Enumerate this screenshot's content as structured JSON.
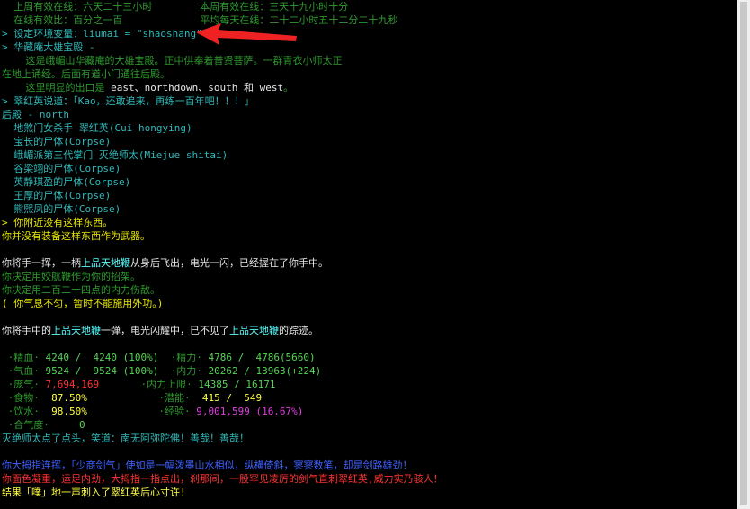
{
  "window": {
    "title": ""
  },
  "lines": {
    "l1a": "  上周有效在线：六天二十三小时",
    "l1b": "本周有效在线：三天十九小时十分",
    "l2a": "  在线有效比：百分之一百",
    "l2b": "平均每天在线：二十二小时五十二分二十九秒",
    "l3": "> 设定环境变量：liumai = \"shaoshang\"",
    "l4": "> 华藏庵大雄宝殿 -",
    "l5": "    这是峨嵋山华藏庵的大雄宝殿。正中供奉着普贤菩萨。一群青衣小师太正",
    "l6": "在地上诵经。后面有道小门通往后殿。",
    "l7a": "    这里明显的出口是 ",
    "l7b": "east、northdown、south 和 west",
    "l7c": "。",
    "l8": "> 翠红英说道：「Kao，还敢追来，再练一百年吧！！！」",
    "l9": "后殿 - north",
    "l10": "  地煞门女杀手 翠红英(Cui hongying)",
    "l11": "  宝长的尸体(Corpse)",
    "l12": "  峨嵋派第三代掌门 灭绝师太(Miejue shitai)",
    "l13": "  谷梁翊的尸体(Corpse)",
    "l14": "  英静琪盈的尸体(Corpse)",
    "l15": "  王厚的尸体(Corpse)",
    "l16": "  熊熙凤的尸体(Corpse)",
    "l17": "> 你附近没有这样东西。",
    "l18": "你并没有装备这样东西作为武器。",
    "l19a": "你将手一挥，一柄",
    "l19b": "上品天地鞭",
    "l19c": "从身后飞出，电光一闪，已经握在了你手中。",
    "l20": "你决定用姣航鞭作为你的招架。",
    "l21": "你决定用二百二十四点的内力伤敌。",
    "l22": "( 你气息不匀，暂时不能施用外功。)",
    "l23a": "你将手中的",
    "l23b": "上品天地鞭",
    "l23c": "一弹，电光闪耀中，已不见了",
    "l23d": "上品天地鞭",
    "l23e": "的踪迹。",
    "l24": "灭绝师太点了点头，笑道：南无阿弥陀佛！善哉！善哉！",
    "l25": "你大拇指连挥，「少商剑气」使如是一幅泼墨山水相似，纵横倚斜，寥寥数笔，却是剑路雄劲！",
    "l26": "你面色凝重，运足内劲，大拇指一指点出，刹那间，一股罕见凌厉的剑气直刺翠红英,威力实乃骇人！",
    "l27": "结果「噗」地一声刺入了翠红英后心寸许!"
  },
  "stats": {
    "jingxue_label": "·精血·",
    "jingxue_val": "4240 /  4240 (100%)",
    "jingli_label": "·精力·",
    "jingli_val": "4786 /  4786(5660)",
    "qixue_label": "·气血·",
    "qixue_val": "9524 /  9524 (100%)",
    "neili_label": "·内力·",
    "neili_val": "20262 / 13963(+224)",
    "pangqi_label": "·庞气·",
    "pangqi_val": "7,694,169",
    "neilimax_label": "·内力上限·",
    "neilimax_val": "14385 / 16171",
    "shiwu_label": "·食物·",
    "shiwu_val": " 87.50%",
    "qianneng_label": "·潜能·",
    "qianneng_val": " 415 /  549",
    "yinshui_label": "·饮水·",
    "yinshui_val": " 98.50%",
    "jingyan_label": "·经验·",
    "jingyan_val": "9,001,599 (16.67%)",
    "heqidu_label": "·合气度·",
    "heqidu_val": "  0"
  }
}
